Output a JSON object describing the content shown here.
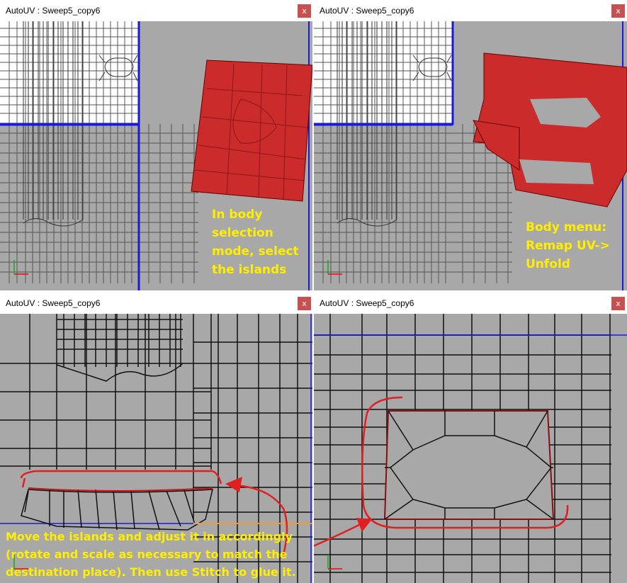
{
  "windows": [
    {
      "title": "AutoUV : Sweep5_copy6",
      "close": "x",
      "annotation": "In body\nselection\nmode, select\nthe islands"
    },
    {
      "title": "AutoUV : Sweep5_copy6",
      "close": "x",
      "annotation": "Body menu:\nRemap UV->\nUnfold"
    },
    {
      "title": "AutoUV : Sweep5_copy6",
      "close": "x",
      "annotation": "Move the islands and adjust it in accordingly\n(rotate and scale as necessary to match the\ndestination place). Then use Stitch to glue it."
    },
    {
      "title": "AutoUV : Sweep5_copy6",
      "close": "x",
      "annotation": ""
    }
  ],
  "colors": {
    "viewport_bg": "#a8a8a8",
    "uv_white_region": "#ffffff",
    "uv_blue_border": "#1a1adb",
    "selected_island": "#cc2b2b",
    "annotation_text": "#ffee00",
    "markup_arrow": "#e02020",
    "close_button": "#c75050"
  }
}
